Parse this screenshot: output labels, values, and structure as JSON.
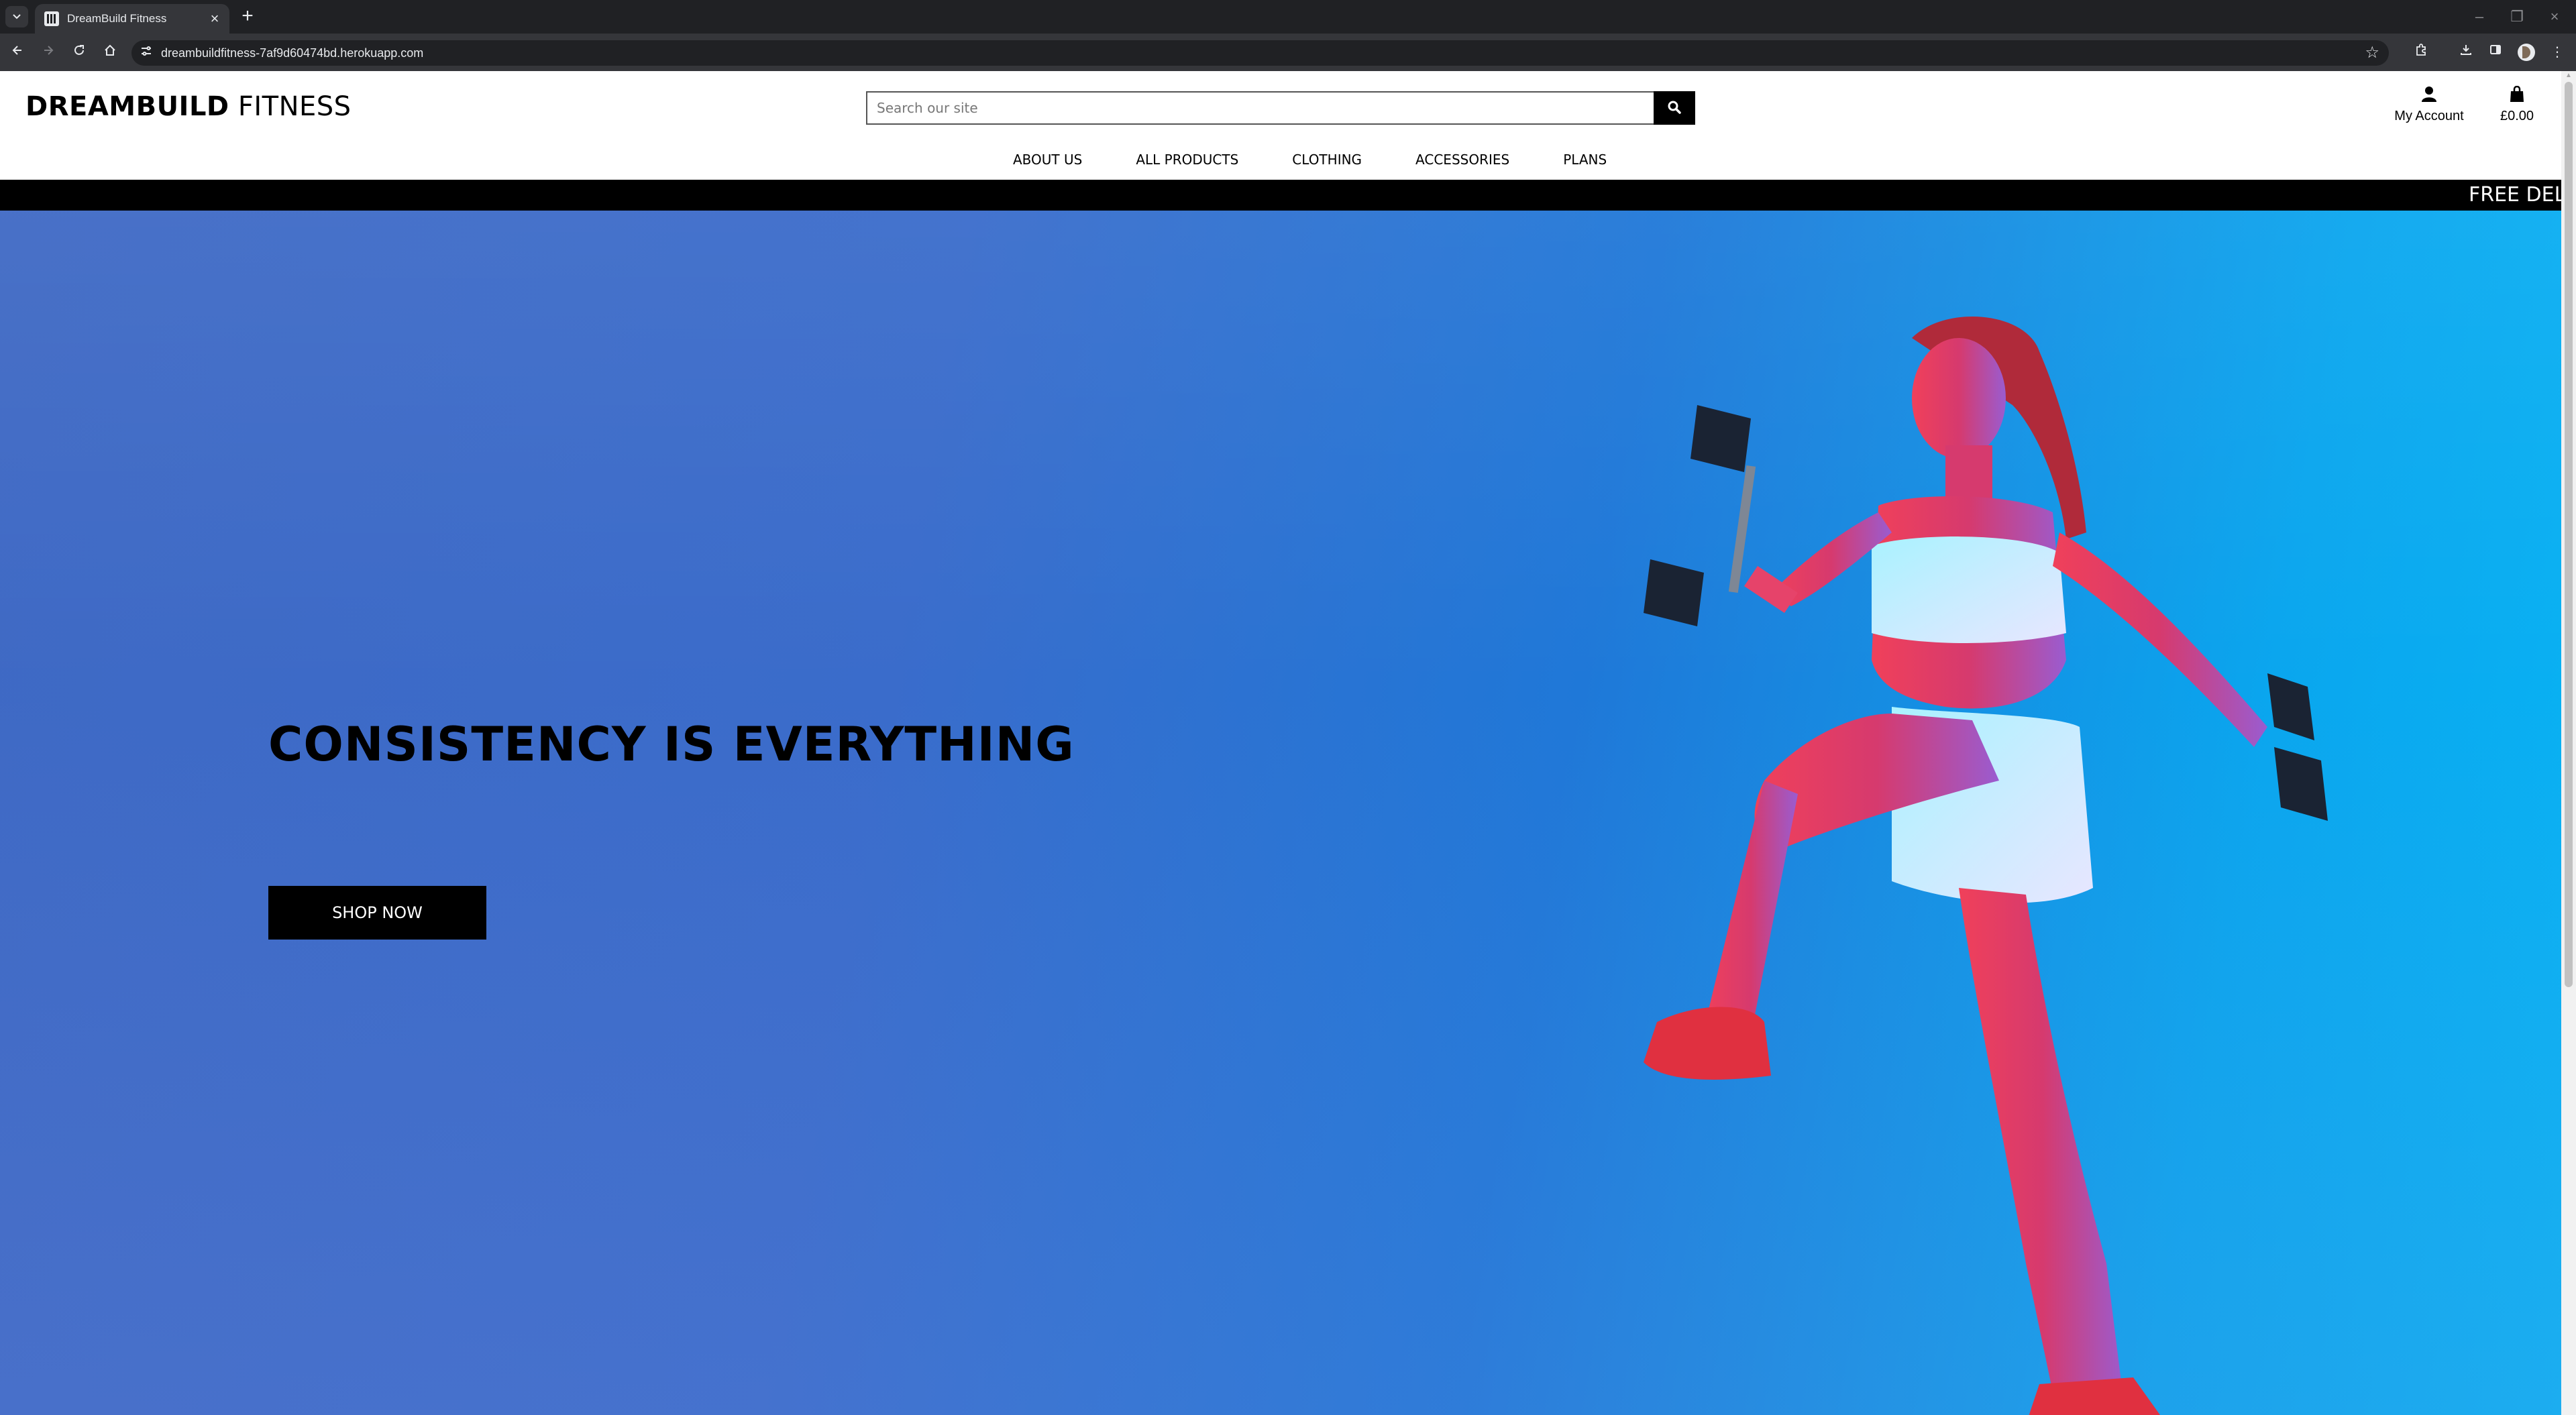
{
  "browser": {
    "tab_title": "DreamBuild Fitness",
    "url": "dreambuildfitness-7af9d60474bd.herokuapp.com"
  },
  "header": {
    "logo_bold": "DREAMBUILD",
    "logo_light": "FITNESS",
    "search_placeholder": "Search our site",
    "account_label": "My Account",
    "bag_total": "£0.00"
  },
  "nav": {
    "items": [
      "ABOUT US",
      "ALL PRODUCTS",
      "CLOTHING",
      "ACCESSORIES",
      "PLANS"
    ]
  },
  "banner": {
    "text": "FREE DELI"
  },
  "hero": {
    "title": "CONSISTENCY IS EVERYTHING",
    "button_label": "SHOP NOW"
  },
  "colors": {
    "hero_left": "#3f69c4",
    "hero_right": "#08b4f4",
    "banner_bg": "#000000",
    "text": "#000000"
  },
  "icons": [
    "tab-list-icon",
    "favicon-icon",
    "tab-close-icon",
    "new-tab-icon",
    "minimize-icon",
    "restore-icon",
    "window-close-icon",
    "back-icon",
    "forward-icon",
    "reload-icon",
    "home-icon",
    "site-info-icon",
    "bookmark-star-icon",
    "extensions-icon",
    "downloads-icon",
    "side-panel-icon",
    "profile-avatar-icon",
    "chrome-menu-icon",
    "search-icon",
    "user-icon",
    "shopping-bag-icon"
  ]
}
